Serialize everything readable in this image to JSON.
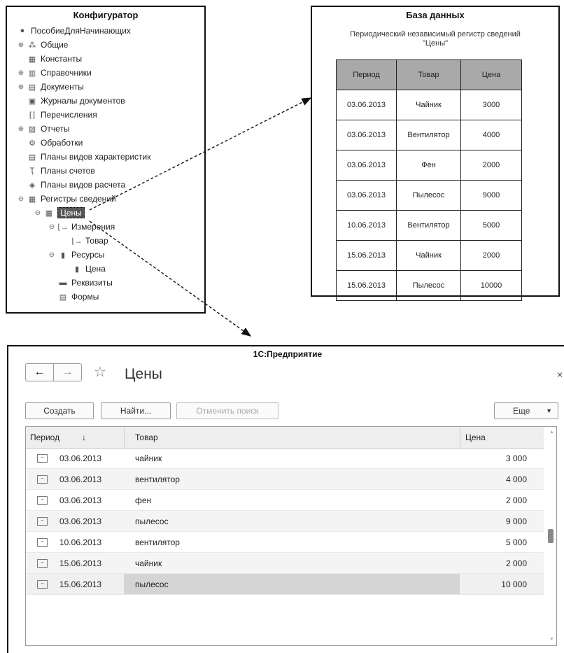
{
  "configurator": {
    "title": "Конфигуратор",
    "items": [
      {
        "label": "ПособиеДляНачинающих",
        "icon": "config-root-icon"
      },
      {
        "label": "Общие",
        "icon": "common-icon"
      },
      {
        "label": "Константы",
        "icon": "constants-icon"
      },
      {
        "label": "Справочники",
        "icon": "catalogs-icon"
      },
      {
        "label": "Документы",
        "icon": "documents-icon"
      },
      {
        "label": "Журналы документов",
        "icon": "journals-icon"
      },
      {
        "label": "Перечисления",
        "icon": "enums-icon"
      },
      {
        "label": "Отчеты",
        "icon": "reports-icon"
      },
      {
        "label": "Обработки",
        "icon": "processing-icon"
      },
      {
        "label": "Планы видов характеристик",
        "icon": "chart-of-characteristics-icon"
      },
      {
        "label": "Планы счетов",
        "icon": "chart-of-accounts-icon"
      },
      {
        "label": "Планы видов расчета",
        "icon": "calculation-types-icon"
      },
      {
        "label": "Регистры сведений",
        "icon": "info-registers-icon"
      },
      {
        "label": "Цены",
        "icon": "register-icon"
      },
      {
        "label": "Измерения",
        "icon": "dimensions-icon"
      },
      {
        "label": "Товар",
        "icon": "dimension-icon"
      },
      {
        "label": "Ресурсы",
        "icon": "resources-icon"
      },
      {
        "label": "Цена",
        "icon": "resource-icon"
      },
      {
        "label": "Реквизиты",
        "icon": "attributes-icon"
      },
      {
        "label": "Формы",
        "icon": "forms-icon"
      }
    ]
  },
  "database": {
    "title": "База данных",
    "subtitle_line1": "Периодический независимый регистр сведений",
    "subtitle_line2": "\"Цены\"",
    "columns": [
      "Период",
      "Товар",
      "Цена"
    ],
    "rows": [
      [
        "03.06.2013",
        "Чайник",
        "3000"
      ],
      [
        "03.06.2013",
        "Вентилятор",
        "4000"
      ],
      [
        "03.06.2013",
        "Фен",
        "2000"
      ],
      [
        "03.06.2013",
        "Пылесос",
        "9000"
      ],
      [
        "10.06.2013",
        "Вентилятор",
        "5000"
      ],
      [
        "15.06.2013",
        "Чайник",
        "2000"
      ],
      [
        "15.06.2013",
        "Пылесос",
        "10000"
      ]
    ]
  },
  "enterprise": {
    "window_title": "1С:Предприятие",
    "back_glyph": "←",
    "forward_glyph": "→",
    "star_glyph": "☆",
    "form_title": "Цены",
    "close_glyph": "×",
    "buttons": {
      "create": "Создать",
      "find": "Найти...",
      "cancel_search": "Отменить поиск",
      "more": "Еще",
      "more_arrow": "▼"
    },
    "columns": {
      "period": "Период",
      "sort_glyph": "↓",
      "goods": "Товар",
      "price": "Цена"
    },
    "rows": [
      {
        "period": "03.06.2013",
        "goods": "чайник",
        "price": "3 000"
      },
      {
        "period": "03.06.2013",
        "goods": "вентилятор",
        "price": "4 000"
      },
      {
        "period": "03.06.2013",
        "goods": "фен",
        "price": "2 000"
      },
      {
        "period": "03.06.2013",
        "goods": "пылесос",
        "price": "9 000"
      },
      {
        "period": "10.06.2013",
        "goods": "вентилятор",
        "price": "5 000"
      },
      {
        "period": "15.06.2013",
        "goods": "чайник",
        "price": "2 000"
      },
      {
        "period": "15.06.2013",
        "goods": "пылесос",
        "price": "10 000"
      }
    ]
  }
}
